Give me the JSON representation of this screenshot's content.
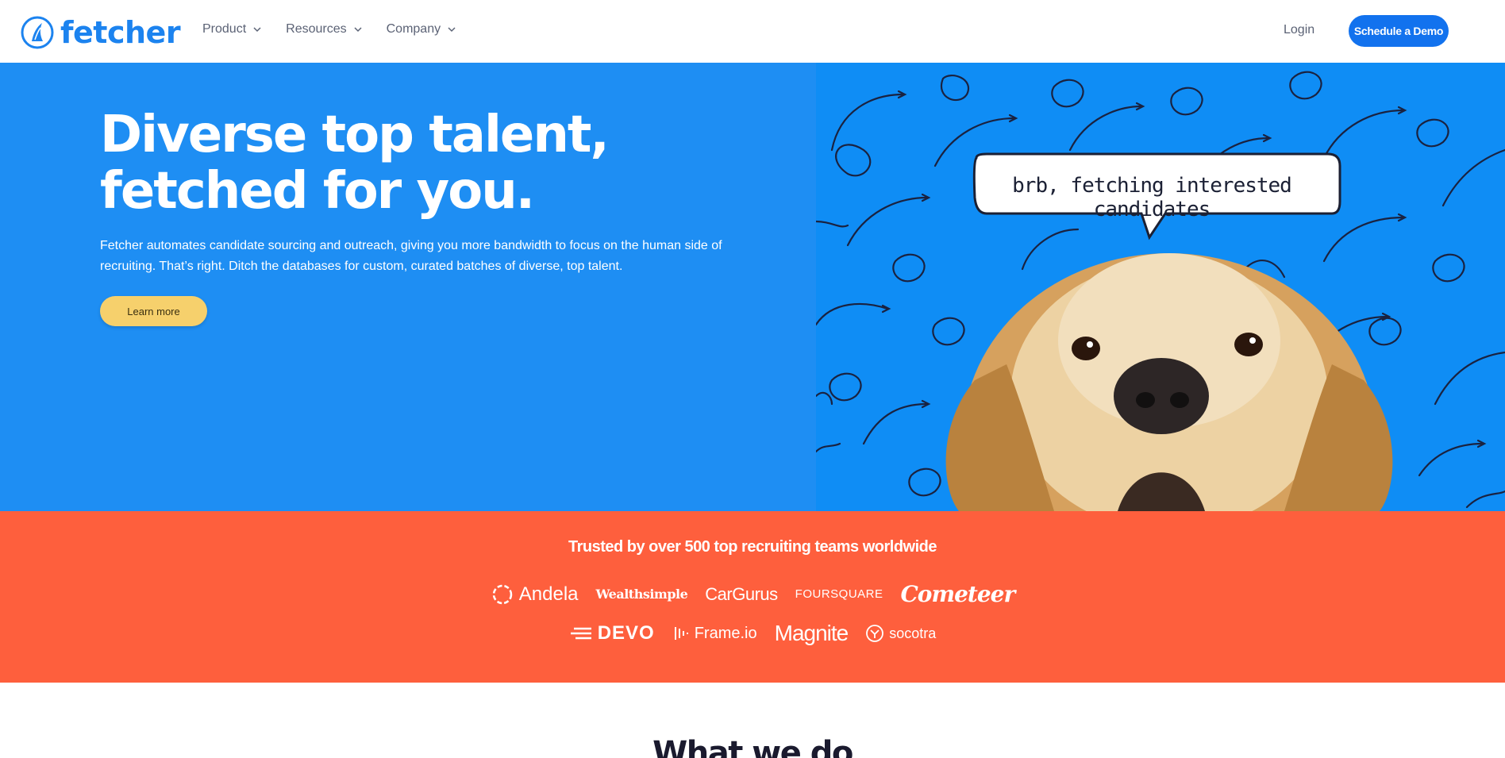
{
  "header": {
    "brand": "fetcher",
    "nav": [
      {
        "label": "Product"
      },
      {
        "label": "Resources"
      },
      {
        "label": "Company"
      }
    ],
    "login": "Login",
    "cta": "Schedule a Demo"
  },
  "hero": {
    "title": "Diverse top talent, fetched for you.",
    "subtitle": "Fetcher automates candidate sourcing and outreach, giving you more bandwidth to focus on the human side of recruiting. That’s right. Ditch the databases for custom, curated batches of diverse, top talent.",
    "button": "Learn more",
    "speech_bubble": "brb, fetching interested candidates"
  },
  "trust": {
    "title": "Trusted by over 500 top recruiting teams worldwide",
    "logos_row1": [
      "Andela",
      "Wealthsimple",
      "CarGurus",
      "FOURSQUARE",
      "Cometeer"
    ],
    "logos_row2": [
      "DEVO",
      "Frame.io",
      "Magnite",
      "socotra"
    ]
  },
  "section_next": {
    "title": "What we do"
  },
  "colors": {
    "brand_blue": "#1c83ef",
    "hero_left": "#1e8ef3",
    "hero_right": "#0f8df5",
    "cta_blue": "#1272ee",
    "learn_yellow": "#f6d06c",
    "trust_orange": "#fe5f3d"
  },
  "icons": [
    "fetcher-logo-icon",
    "chevron-down-icon",
    "andela-logo-icon",
    "devo-logo-icon",
    "frameio-logo-icon",
    "socotra-logo-icon"
  ]
}
